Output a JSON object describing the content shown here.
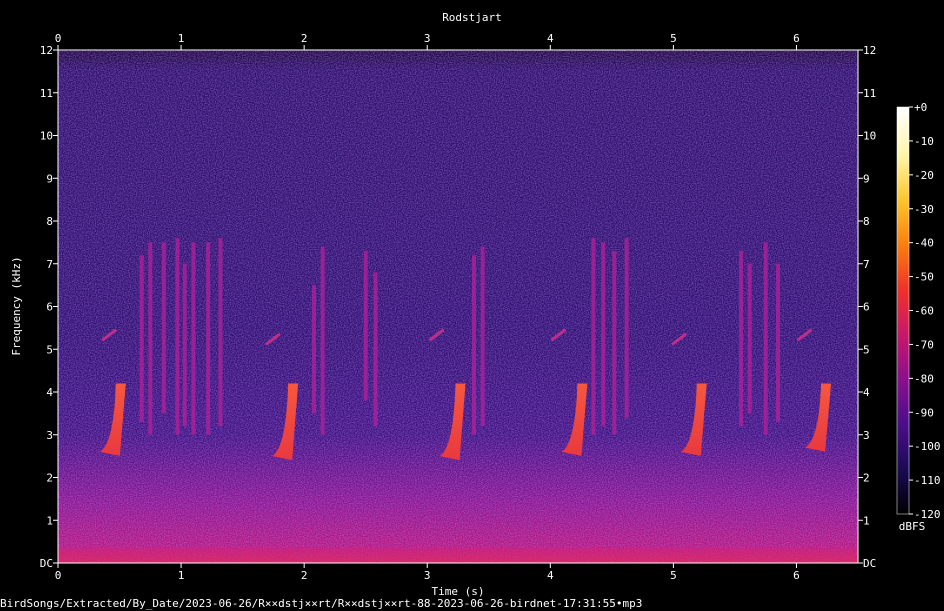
{
  "footer_path": "BirdSongs/Extracted/By_Date/2023-06-26/R××dstj××rt/R××dstj××rt-88-2023-06-26-birdnet-17:31:55•mp3",
  "chart_data": {
    "type": "heatmap",
    "title": "Rodstjart",
    "xlabel": "Time (s)",
    "ylabel": "Frequency (kHz)",
    "xlim": [
      0,
      6.5
    ],
    "ylim": [
      0,
      12
    ],
    "x_ticks": [
      "0",
      "1",
      "2",
      "3",
      "4",
      "5",
      "6"
    ],
    "y_ticks": [
      "DC",
      "1",
      "2",
      "3",
      "4",
      "5",
      "6",
      "7",
      "8",
      "9",
      "10",
      "11",
      "12"
    ],
    "colorbar": {
      "label": "dBFS",
      "ticks": [
        "+0",
        "-10",
        "-20",
        "-30",
        "-40",
        "-50",
        "-60",
        "-70",
        "-80",
        "-90",
        "-100",
        "-110",
        "-120"
      ],
      "range": [
        -120,
        0
      ],
      "colors": [
        "#000000",
        "#1a0a55",
        "#4a0e8a",
        "#8a0f8c",
        "#c8176a",
        "#f0302a",
        "#fb7d0e",
        "#fcc52a",
        "#fff6a8",
        "#ffffff"
      ]
    },
    "calls": [
      {
        "t": 0.47,
        "f_low": 2.6,
        "f_high": 4.2
      },
      {
        "t": 1.87,
        "f_low": 2.5,
        "f_high": 4.2
      },
      {
        "t": 3.23,
        "f_low": 2.5,
        "f_high": 4.2
      },
      {
        "t": 4.22,
        "f_low": 2.6,
        "f_high": 4.2
      },
      {
        "t": 5.19,
        "f_low": 2.6,
        "f_high": 4.2
      },
      {
        "t": 6.2,
        "f_low": 2.7,
        "f_high": 4.2
      }
    ],
    "whistles": [
      {
        "t": 0.4,
        "f": 5.3
      },
      {
        "t": 1.73,
        "f": 5.2
      },
      {
        "t": 3.06,
        "f": 5.3
      },
      {
        "t": 4.05,
        "f": 5.3
      },
      {
        "t": 5.03,
        "f": 5.2
      },
      {
        "t": 6.05,
        "f": 5.3
      }
    ],
    "clicks": [
      {
        "t": 0.68,
        "f_low": 3.3,
        "f_high": 7.2
      },
      {
        "t": 0.75,
        "f_low": 3.0,
        "f_high": 7.5
      },
      {
        "t": 0.86,
        "f_low": 3.5,
        "f_high": 7.5
      },
      {
        "t": 0.97,
        "f_low": 3.0,
        "f_high": 7.6
      },
      {
        "t": 1.03,
        "f_low": 3.2,
        "f_high": 7.0
      },
      {
        "t": 1.1,
        "f_low": 3.0,
        "f_high": 7.5
      },
      {
        "t": 1.22,
        "f_low": 3.0,
        "f_high": 7.5
      },
      {
        "t": 1.32,
        "f_low": 3.2,
        "f_high": 7.6
      },
      {
        "t": 2.08,
        "f_low": 3.5,
        "f_high": 6.5
      },
      {
        "t": 2.15,
        "f_low": 3.0,
        "f_high": 7.4
      },
      {
        "t": 2.5,
        "f_low": 3.8,
        "f_high": 7.3
      },
      {
        "t": 2.58,
        "f_low": 3.2,
        "f_high": 6.8
      },
      {
        "t": 3.38,
        "f_low": 3.0,
        "f_high": 7.2
      },
      {
        "t": 3.45,
        "f_low": 3.2,
        "f_high": 7.4
      },
      {
        "t": 4.35,
        "f_low": 3.0,
        "f_high": 7.6
      },
      {
        "t": 4.43,
        "f_low": 3.2,
        "f_high": 7.5
      },
      {
        "t": 4.52,
        "f_low": 3.0,
        "f_high": 7.3
      },
      {
        "t": 4.62,
        "f_low": 3.4,
        "f_high": 7.6
      },
      {
        "t": 5.55,
        "f_low": 3.2,
        "f_high": 7.3
      },
      {
        "t": 5.62,
        "f_low": 3.5,
        "f_high": 7.0
      },
      {
        "t": 5.75,
        "f_low": 3.0,
        "f_high": 7.5
      },
      {
        "t": 5.85,
        "f_low": 3.3,
        "f_high": 7.0
      }
    ]
  }
}
